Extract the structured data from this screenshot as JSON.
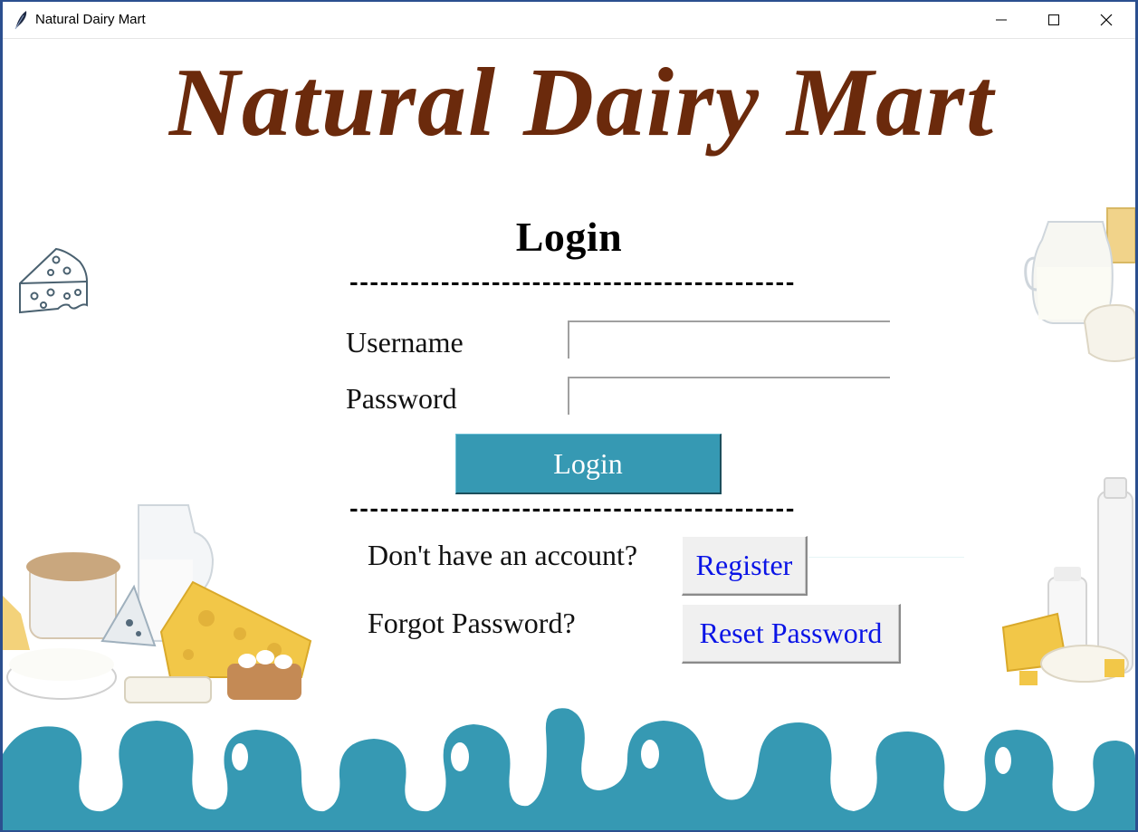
{
  "window": {
    "title": "Natural Dairy Mart",
    "controls": [
      "minimize",
      "maximize",
      "close"
    ]
  },
  "header": {
    "logo_text": "Natural Dairy Mart"
  },
  "form": {
    "heading": "Login",
    "divider_top": "--------------------------------------------",
    "username_label": "Username",
    "username_value": "",
    "password_label": "Password",
    "password_value": "",
    "login_button": "Login",
    "divider_bottom": "--------------------------------------------"
  },
  "links": {
    "no_account_text": "Don't have an account?",
    "register_button": "Register",
    "forgot_text": "Forgot Password?",
    "reset_button": "Reset Password"
  },
  "colors": {
    "accent": "#3699b3",
    "logo_brown": "#6b2a0c",
    "link_blue": "#0a14e6"
  },
  "icons": [
    "feather-icon",
    "cheese-icon",
    "minimize-icon",
    "maximize-icon",
    "close-icon"
  ]
}
